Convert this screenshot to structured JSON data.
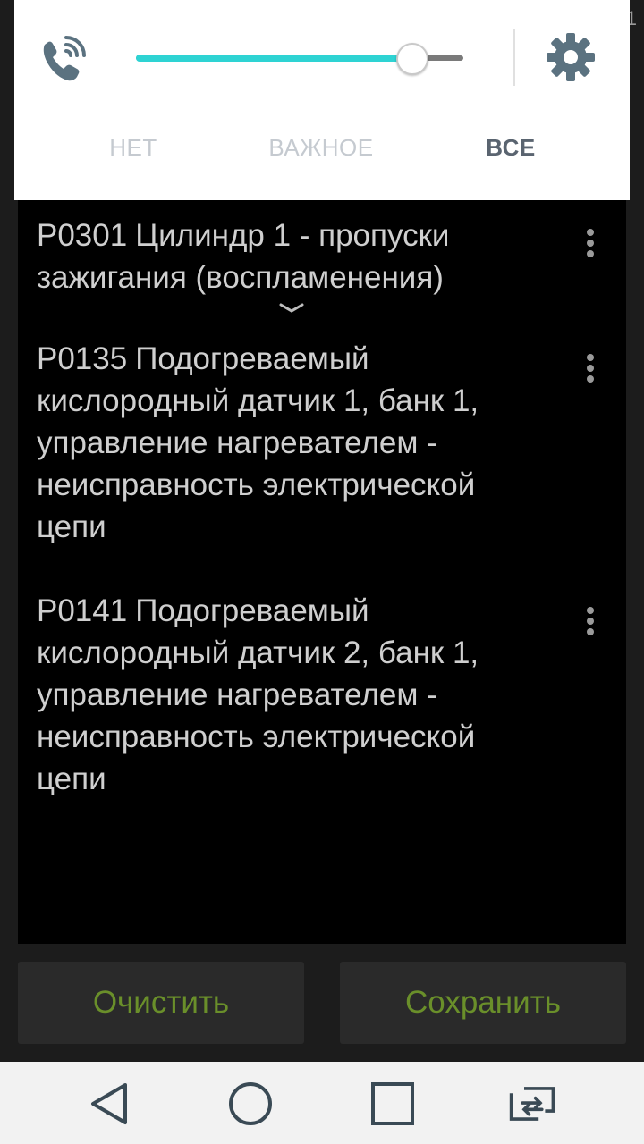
{
  "status_bar": {
    "fragment": "1"
  },
  "volume_panel": {
    "slider": {
      "level_percent": 84
    },
    "tabs": [
      {
        "label": "НЕТ",
        "active": false
      },
      {
        "label": "ВАЖНОЕ",
        "active": false
      },
      {
        "label": "ВСЕ",
        "active": true
      }
    ],
    "icons": {
      "left": "ringer-phone-icon",
      "right": "gear-icon"
    },
    "accent_color": "#2ed3d3"
  },
  "dtc_list": {
    "items": [
      {
        "code": "P0301",
        "description": "Цилиндр 1 - пропуски зажигания (воспламенения)"
      },
      {
        "code": "P0135",
        "description": "Подогреваемый кислородный датчик 1, банк 1, управление нагревателем - неисправность электрической цепи"
      },
      {
        "code": "P0141",
        "description": "Подогреваемый кислородный датчик 2, банк 1, управление нагревателем - неисправность электрической цепи"
      }
    ]
  },
  "actions": {
    "clear_label": "Очистить",
    "save_label": "Сохранить",
    "button_text_color": "#6a8f2a"
  },
  "nav_bar": {
    "icons": [
      "back-icon",
      "home-icon",
      "recents-icon",
      "dual-window-icon"
    ]
  }
}
